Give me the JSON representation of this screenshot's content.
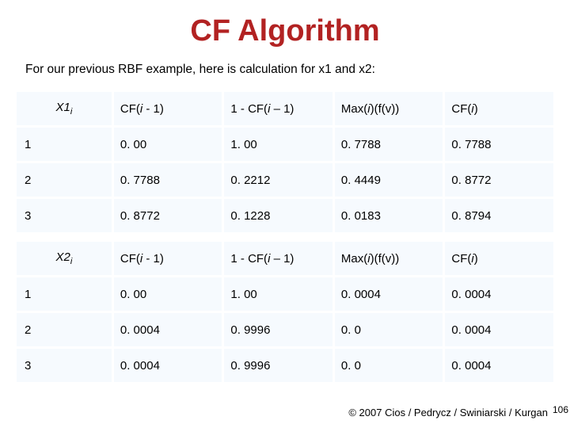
{
  "title": "CF Algorithm",
  "intro": "For our previous RBF example, here is calculation for x1 and x2:",
  "table1": {
    "rowlabel_html": "X1<span class=\"sub\">i</span>",
    "headers": {
      "h1_html": "CF(<span class=\"i\">i</span> - 1)",
      "h2_html": "1 - CF(<span class=\"i\">i</span> – 1)",
      "h3_html": "Max(<span class=\"i\">i</span>)(f(v))",
      "h4_html": "CF(<span class=\"i\">i</span>)"
    },
    "rows": [
      {
        "n": "1",
        "c1": "0. 00",
        "c2": "1. 00",
        "c3": "0. 7788",
        "c4": "0. 7788"
      },
      {
        "n": "2",
        "c1": "0. 7788",
        "c2": "0. 2212",
        "c3": "0. 4449",
        "c4": "0. 8772"
      },
      {
        "n": "3",
        "c1": "0. 8772",
        "c2": "0. 1228",
        "c3": "0. 0183",
        "c4": "0. 8794"
      }
    ]
  },
  "table2": {
    "rowlabel_html": "X2<span class=\"sub\">i</span>",
    "headers": {
      "h1_html": "CF(<span class=\"i\">i</span> - 1)",
      "h2_html": "1 - CF(<span class=\"i\">i</span> – 1)",
      "h3_html": "Max(<span class=\"i\">i</span>)(f(v))",
      "h4_html": "CF(<span class=\"i\">i</span>)"
    },
    "rows": [
      {
        "n": "1",
        "c1": "0. 00",
        "c2": "1. 00",
        "c3": "0. 0004",
        "c4": "0. 0004"
      },
      {
        "n": "2",
        "c1": "0. 0004",
        "c2": "0. 9996",
        "c3": "0. 0",
        "c4": "0. 0004"
      },
      {
        "n": "3",
        "c1": "0. 0004",
        "c2": "0. 9996",
        "c3": "0. 0",
        "c4": "0. 0004"
      }
    ]
  },
  "footer": "© 2007 Cios / Pedrycz / Swiniarski / Kurgan",
  "pagenum": "106",
  "chart_data": [
    {
      "type": "table",
      "title": "X1i",
      "columns": [
        "i",
        "CF(i-1)",
        "1-CF(i-1)",
        "Max(i)(f(v))",
        "CF(i)"
      ],
      "rows": [
        [
          1,
          0.0,
          1.0,
          0.7788,
          0.7788
        ],
        [
          2,
          0.7788,
          0.2212,
          0.4449,
          0.8772
        ],
        [
          3,
          0.8772,
          0.1228,
          0.0183,
          0.8794
        ]
      ]
    },
    {
      "type": "table",
      "title": "X2i",
      "columns": [
        "i",
        "CF(i-1)",
        "1-CF(i-1)",
        "Max(i)(f(v))",
        "CF(i)"
      ],
      "rows": [
        [
          1,
          0.0,
          1.0,
          0.0004,
          0.0004
        ],
        [
          2,
          0.0004,
          0.9996,
          0.0,
          0.0004
        ],
        [
          3,
          0.0004,
          0.9996,
          0.0,
          0.0004
        ]
      ]
    }
  ]
}
